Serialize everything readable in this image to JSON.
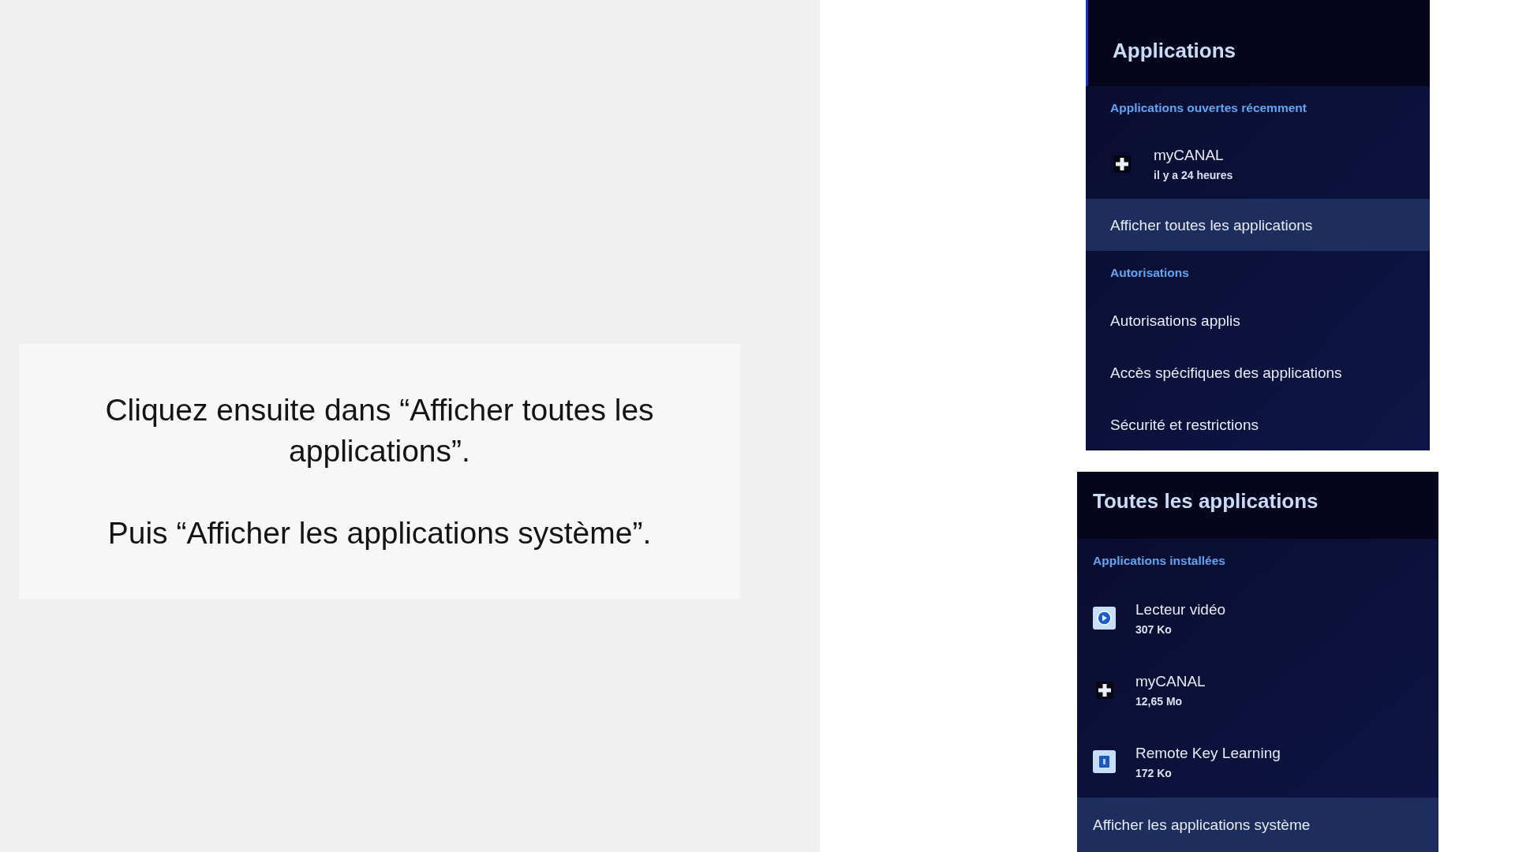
{
  "instruction_card": {
    "paragraphs": [
      "Cliquez ensuite dans “Afficher toutes les applications”.",
      "Puis “Afficher les applications système”."
    ]
  },
  "screenshots": [
    {
      "title": "Applications",
      "items": [
        {
          "kind": "section",
          "label": "Applications ouvertes récemment"
        },
        {
          "kind": "app",
          "name": "myCANAL",
          "detail": "il y a 24 heures",
          "selected": false
        },
        {
          "kind": "link",
          "label": "Afficher toutes les applications",
          "selected": true
        },
        {
          "kind": "section",
          "label": "Autorisations"
        },
        {
          "kind": "link",
          "label": "Autorisations applis",
          "selected": false
        },
        {
          "kind": "link",
          "label": "Accès spécifiques des applications",
          "selected": false
        },
        {
          "kind": "link",
          "label": "Sécurité et restrictions",
          "selected": false
        }
      ]
    },
    {
      "title": "Toutes les applications",
      "items": [
        {
          "kind": "section",
          "label": "Applications installées"
        },
        {
          "kind": "app",
          "name": "Lecteur vidéo",
          "detail": "307 Ko",
          "selected": false
        },
        {
          "kind": "app",
          "name": "myCANAL",
          "detail": "12,65 Mo",
          "selected": false
        },
        {
          "kind": "app",
          "name": "Remote Key Learning",
          "detail": "172 Ko",
          "selected": false
        },
        {
          "kind": "link",
          "label": "Afficher les applications système",
          "selected": true
        }
      ]
    }
  ]
}
